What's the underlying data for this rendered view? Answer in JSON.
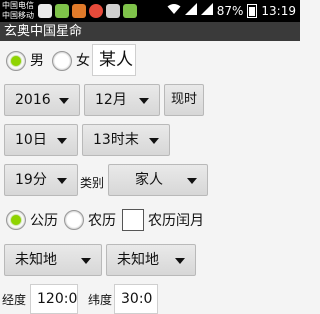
{
  "status_bar": {
    "carrier_1": "中国电信",
    "carrier_2": "中国移动",
    "battery": "87%",
    "time": "13:19"
  },
  "app": {
    "title": "玄奥中国星命"
  },
  "gender": {
    "male": "男",
    "female": "女",
    "selected": "male"
  },
  "name_input": {
    "value": "某人"
  },
  "year": {
    "value": "2016"
  },
  "month": {
    "value": "12月"
  },
  "now_button": {
    "label": "现时"
  },
  "day": {
    "value": "10日"
  },
  "hour": {
    "value": "13时末"
  },
  "minute": {
    "value": "19分"
  },
  "category": {
    "label": "类别",
    "value": "家人"
  },
  "calendar": {
    "solar": "公历",
    "lunar": "农历",
    "lunar_leap": "农历闰月",
    "selected": "solar"
  },
  "place_1": {
    "value": "未知地"
  },
  "place_2": {
    "value": "未知地"
  },
  "bottom_row": {
    "label_1": "经度",
    "value_1": "120:0",
    "label_2": "纬度",
    "value_2": "30:0"
  }
}
